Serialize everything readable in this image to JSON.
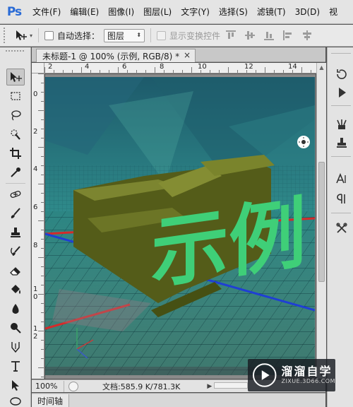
{
  "app": {
    "logo": "Ps"
  },
  "menu": [
    "文件(F)",
    "编辑(E)",
    "图像(I)",
    "图层(L)",
    "文字(Y)",
    "选择(S)",
    "滤镜(T)",
    "3D(D)",
    "视"
  ],
  "options_bar": {
    "auto_select_label": "自动选择：",
    "auto_select_checked": false,
    "target_value": "图层",
    "show_transform_label": "显示变换控件",
    "show_transform_checked": false
  },
  "document": {
    "tab_title": "未标题-1 @ 100% (示例, RGB/8) *",
    "close_glyph": "×",
    "canvas_text": "示例"
  },
  "rulers": {
    "horizontal": [
      "2",
      "4",
      "6",
      "8",
      "10",
      "12",
      "14"
    ],
    "vertical": [
      "0",
      "2",
      "4",
      "6",
      "8",
      "1\n0",
      "1\n2"
    ]
  },
  "status": {
    "zoom": "100%",
    "doc_info": "文档:585.9 K/781.3K"
  },
  "timeline": {
    "tab_label": "时间轴"
  },
  "watermark": {
    "cn": "溜溜自学",
    "en": "ZIXUE.3D66.COM"
  },
  "colors": {
    "accent_blue": "#2a6bd6",
    "panel_bg": "#e3e3e3",
    "workspace": "#535353",
    "text_face": "#3fcf78",
    "text_extrude": "#6b7420"
  },
  "icons": {
    "tools": [
      "move-icon",
      "marquee-icon",
      "lasso-icon",
      "quick-select-icon",
      "crop-icon",
      "eyedropper-icon",
      "healing-brush-icon",
      "brush-icon",
      "clone-stamp-icon",
      "history-brush-icon",
      "eraser-icon",
      "paint-bucket-icon",
      "blur-icon",
      "dodge-icon",
      "pen-icon",
      "type-icon",
      "path-select-icon",
      "shape-icon"
    ],
    "right_panel": [
      "history-icon",
      "actions-icon",
      "brush-presets-icon",
      "clone-source-icon",
      "character-icon",
      "paragraph-icon",
      "tool-presets-icon"
    ]
  }
}
